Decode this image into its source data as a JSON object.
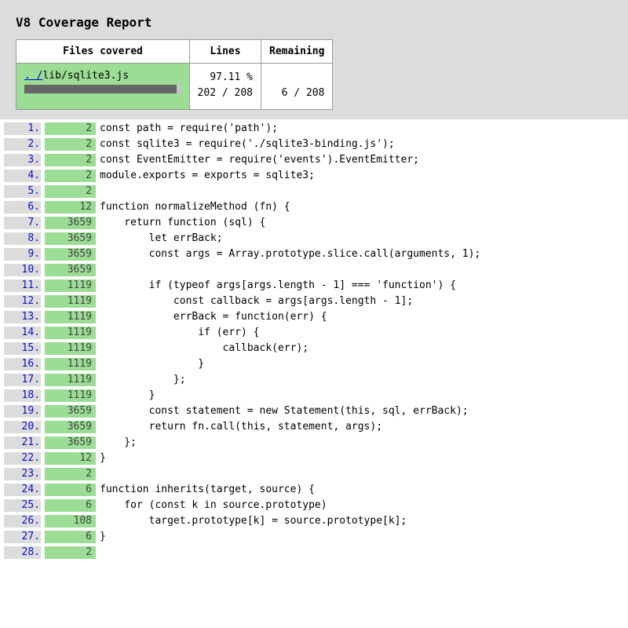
{
  "report": {
    "title": "V8 Coverage Report"
  },
  "summary": {
    "headers": {
      "files": "Files covered",
      "lines": "Lines",
      "remaining": "Remaining"
    },
    "file_prefix": ". /",
    "file_path": "lib/sqlite3.js",
    "percent": "97.11 %",
    "covered": "202 / 208",
    "remaining": "6 / 208",
    "coverage_fraction": 0.9711
  },
  "colors": {
    "covered_green": "#9bdd95",
    "header_gray": "#dcdcdc",
    "line_number_blue": "#1010c0"
  },
  "code_lines": [
    {
      "n": "1.",
      "c": "2",
      "t": "const path = require('path');"
    },
    {
      "n": "2.",
      "c": "2",
      "t": "const sqlite3 = require('./sqlite3-binding.js');"
    },
    {
      "n": "3.",
      "c": "2",
      "t": "const EventEmitter = require('events').EventEmitter;"
    },
    {
      "n": "4.",
      "c": "2",
      "t": "module.exports = exports = sqlite3;"
    },
    {
      "n": "5.",
      "c": "2",
      "t": ""
    },
    {
      "n": "6.",
      "c": "12",
      "t": "function normalizeMethod (fn) {"
    },
    {
      "n": "7.",
      "c": "3659",
      "t": "    return function (sql) {"
    },
    {
      "n": "8.",
      "c": "3659",
      "t": "        let errBack;"
    },
    {
      "n": "9.",
      "c": "3659",
      "t": "        const args = Array.prototype.slice.call(arguments, 1);"
    },
    {
      "n": "10.",
      "c": "3659",
      "t": ""
    },
    {
      "n": "11.",
      "c": "1119",
      "t": "        if (typeof args[args.length - 1] === 'function') {"
    },
    {
      "n": "12.",
      "c": "1119",
      "t": "            const callback = args[args.length - 1];"
    },
    {
      "n": "13.",
      "c": "1119",
      "t": "            errBack = function(err) {"
    },
    {
      "n": "14.",
      "c": "1119",
      "t": "                if (err) {"
    },
    {
      "n": "15.",
      "c": "1119",
      "t": "                    callback(err);"
    },
    {
      "n": "16.",
      "c": "1119",
      "t": "                }"
    },
    {
      "n": "17.",
      "c": "1119",
      "t": "            };"
    },
    {
      "n": "18.",
      "c": "1119",
      "t": "        }"
    },
    {
      "n": "19.",
      "c": "3659",
      "t": "        const statement = new Statement(this, sql, errBack);"
    },
    {
      "n": "20.",
      "c": "3659",
      "t": "        return fn.call(this, statement, args);"
    },
    {
      "n": "21.",
      "c": "3659",
      "t": "    };"
    },
    {
      "n": "22.",
      "c": "12",
      "t": "}"
    },
    {
      "n": "23.",
      "c": "2",
      "t": ""
    },
    {
      "n": "24.",
      "c": "6",
      "t": "function inherits(target, source) {"
    },
    {
      "n": "25.",
      "c": "6",
      "t": "    for (const k in source.prototype)"
    },
    {
      "n": "26.",
      "c": "108",
      "t": "        target.prototype[k] = source.prototype[k];"
    },
    {
      "n": "27.",
      "c": "6",
      "t": "}"
    },
    {
      "n": "28.",
      "c": "2",
      "t": ""
    }
  ]
}
